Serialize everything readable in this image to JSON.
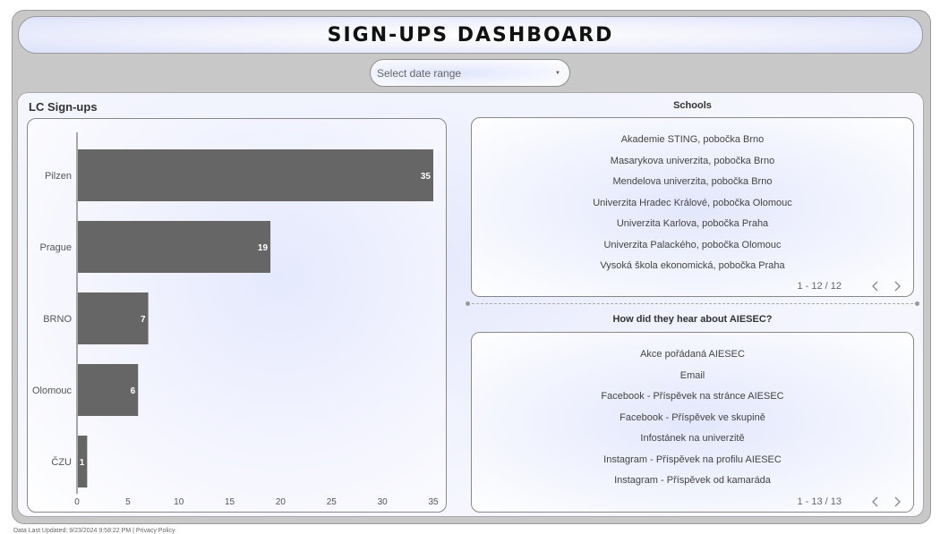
{
  "header": {
    "title": "SIGN-UPS DASHBOARD"
  },
  "filter": {
    "date_range_placeholder": "Select date range"
  },
  "lc_panel": {
    "title": "LC Sign-ups"
  },
  "chart_data": {
    "type": "bar",
    "orientation": "horizontal",
    "title": "LC Sign-ups",
    "categories": [
      "Pilzen",
      "Prague",
      "BRNO",
      "Olomouc",
      "ČZU"
    ],
    "values": [
      35,
      19,
      7,
      6,
      1
    ],
    "xlim": [
      0,
      35
    ],
    "xticks": [
      0,
      5,
      10,
      15,
      20,
      25,
      30,
      35
    ],
    "bar_color": "#666666",
    "data_labels": true,
    "grid": false
  },
  "schools": {
    "title": "Schools",
    "items": [
      "Akademie STING, pobočka Brno",
      "Masarykova univerzita, pobočka Brno",
      "Mendelova univerzita, pobočka Brno",
      "Univerzita Hradec Králové, pobočka Olomouc",
      "Univerzita Karlova, pobočka Praha",
      "Univerzita Palackého, pobočka Olomouc",
      "Vysoká škola ekonomická, pobočka Praha"
    ],
    "pagination": "1 - 12 / 12"
  },
  "hear": {
    "title": "How did they hear about AIESEC?",
    "items": [
      "Akce pořádaná AIESEC",
      "Email",
      "Facebook - Příspěvek na stránce AIESEC",
      "Facebook - Příspěvek ve skupině",
      "Infostánek na univerzitě",
      "Instagram - Příspěvek na profilu AIESEC",
      "Instagram - Příspěvek od kamaráda"
    ],
    "pagination": "1 - 13 / 13"
  },
  "footer": {
    "updated": "Data Last Updated: 9/23/2024 9:58:22 PM",
    "separator": "|",
    "privacy": "Privacy Policy"
  },
  "colors": {
    "accent_bg": "#dde2fb",
    "frame": "#c8c8c8",
    "bar": "#666666"
  }
}
